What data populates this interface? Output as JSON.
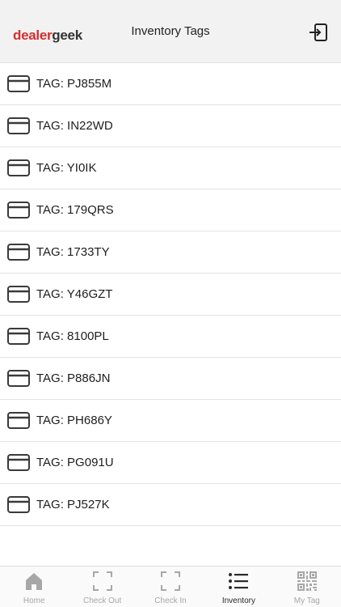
{
  "header": {
    "logo_dealer": "dealer",
    "logo_geek": "geek",
    "title": "Inventory Tags",
    "logout_icon": "logout-icon"
  },
  "tags": [
    {
      "label": "TAG: PJ855M"
    },
    {
      "label": "TAG: IN22WD"
    },
    {
      "label": "TAG: YI0IK"
    },
    {
      "label": "TAG: 179QRS"
    },
    {
      "label": "TAG: 1733TY"
    },
    {
      "label": "TAG: Y46GZT"
    },
    {
      "label": "TAG: 8100PL"
    },
    {
      "label": "TAG: P886JN"
    },
    {
      "label": "TAG: PH686Y"
    },
    {
      "label": "TAG: PG091U"
    },
    {
      "label": "TAG: PJ527K"
    }
  ],
  "tabs": [
    {
      "label": "Home",
      "icon": "home-icon",
      "active": false
    },
    {
      "label": "Check Out",
      "icon": "scan-frame-icon",
      "active": false
    },
    {
      "label": "Check In",
      "icon": "scan-frame-icon",
      "active": false
    },
    {
      "label": "Inventory",
      "icon": "list-icon",
      "active": true
    },
    {
      "label": "My Tag",
      "icon": "qr-code-icon",
      "active": false
    }
  ],
  "colors": {
    "brand_red": "#d32f2f",
    "inactive_tab": "#a7a7a7",
    "active_tab": "#2a2a2a",
    "header_bg": "#f2f2f2"
  }
}
